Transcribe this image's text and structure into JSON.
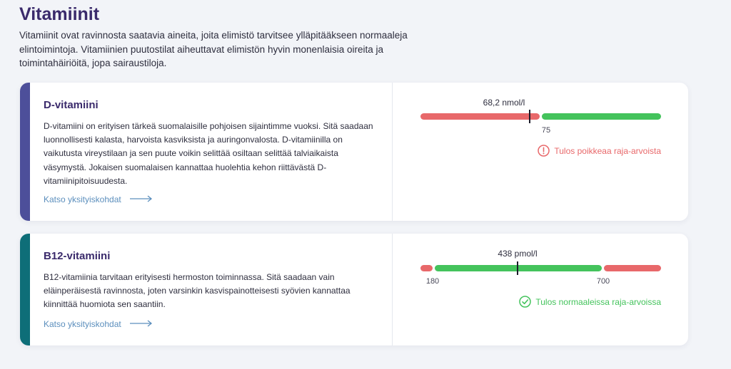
{
  "page": {
    "title": "Vitamiinit",
    "intro": "Vitamiinit ovat ravinnosta saatavia aineita, joita elimistö tarvitsee ylläpitääkseen normaaleja elintoimintoja. Vitamiinien puutostilat aiheuttavat elimistön hyvin monenlaisia oireita ja toimintahäiriöitä, jopa sairaustiloja."
  },
  "colors": {
    "accent_title": "#3a2a6b",
    "d_vitamin_bar": "#4d4f9a",
    "b12_bar": "#0e6e78",
    "range_out": "#e8686a",
    "range_ok": "#44c35c",
    "status_warn": "#e8686a",
    "status_ok": "#44c35c",
    "link": "#5c8fbd"
  },
  "cards": [
    {
      "title": "D-vitamiini",
      "description": "D-vitamiini on erityisen tärkeä suomalaisille pohjoisen sijaintimme vuoksi. Sitä saadaan luonnollisesti kalasta, harvoista kasviksista ja auringonvalosta. D-vitamiinilla on vaikutusta vireystilaan ja sen puute voikin selittää osiltaan selittää talviaikaista väsymystä. Jokaisen suomalaisen kannattaa huolehtia kehon riittävästä D-vitamiinipitoisuudesta.",
      "link_label": "Katso yksityiskohdat",
      "link_icon": "arrow-right-icon",
      "measurement": {
        "value_label": "68,2 nmol/l",
        "value": 68.2,
        "unit": "nmol/l",
        "scale_min": 0,
        "scale_max": 150,
        "ranges": [
          {
            "from": 0,
            "to": 75,
            "status": "out"
          },
          {
            "from": 75,
            "to": 150,
            "status": "ok"
          }
        ],
        "ticks": [
          "75"
        ]
      },
      "status_text": "Tulos poikkeaa raja-arvoista",
      "status_icon": "exclamation-circle-icon",
      "status_type": "warn"
    },
    {
      "title": "B12-vitamiini",
      "description": "B12-vitamiinia tarvitaan erityisesti hermoston toiminnassa. Sitä saadaan vain eläinperäisestä ravinnosta, joten varsinkin kasvispainotteisesti syövien kannattaa kiinnittää huomiota sen saantiin.",
      "link_label": "Katso yksityiskohdat",
      "link_icon": "arrow-right-icon",
      "measurement": {
        "value_label": "438 pmol/l",
        "value": 438,
        "unit": "pmol/l",
        "scale_min": 140,
        "scale_max": 880,
        "ranges": [
          {
            "from": 140,
            "to": 180,
            "status": "out"
          },
          {
            "from": 180,
            "to": 700,
            "status": "ok"
          },
          {
            "from": 700,
            "to": 880,
            "status": "out"
          }
        ],
        "ticks": [
          "180",
          "700"
        ]
      },
      "status_text": "Tulos normaaleissa raja-arvoissa",
      "status_icon": "check-circle-icon",
      "status_type": "ok"
    }
  ]
}
